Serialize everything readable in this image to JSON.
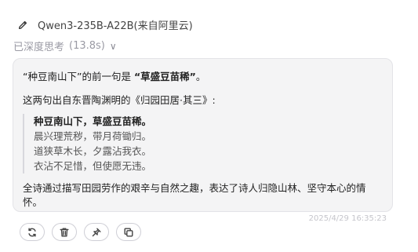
{
  "header": {
    "model_name": "Qwen3-235B-A22B(来自阿里云)",
    "model_icon": "pencil-icon"
  },
  "thinking": {
    "label": "已深度思考",
    "duration": "(13.8s)",
    "chevron": "∨"
  },
  "message": {
    "p1_prefix": "“种豆南山下”的前一句是 ",
    "p1_highlight": "“草盛豆苗稀”",
    "p1_suffix": "。",
    "p2": "这两句出自东晋陶渊明的《归园田居·其三》:",
    "poem": [
      "种豆南山下，草盛豆苗稀。",
      "晨兴理荒秽，带月荷锄归。",
      "道狭草木长，夕露沾我衣。",
      "衣沾不足惜，但使愿无违。"
    ],
    "summary": "全诗通过描写田园劳作的艰辛与自然之趣，表达了诗人归隐山林、坚守本心的情怀。"
  },
  "timestamp": "2025/4/29 16:35:23",
  "actions": [
    {
      "name": "regenerate-button",
      "icon": "refresh-icon"
    },
    {
      "name": "delete-button",
      "icon": "trash-icon"
    },
    {
      "name": "pin-button",
      "icon": "pin-icon"
    },
    {
      "name": "copy-button",
      "icon": "copy-icon"
    }
  ]
}
